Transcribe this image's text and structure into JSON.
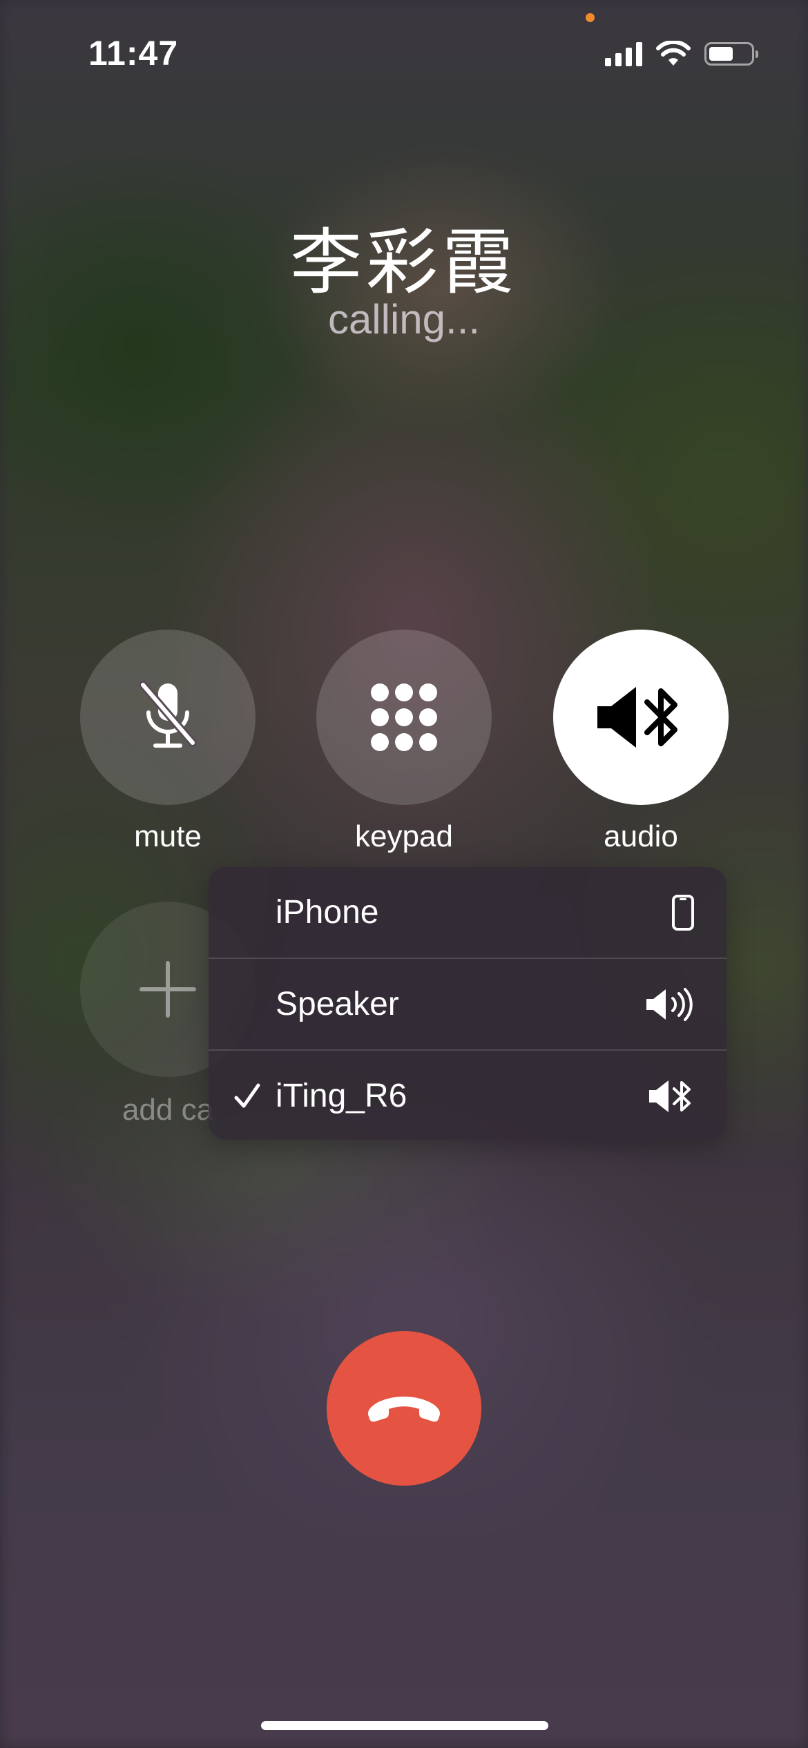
{
  "status_bar": {
    "time": "11:47"
  },
  "call": {
    "caller_name": "李彩霞",
    "status": "calling..."
  },
  "controls": {
    "mute_label": "mute",
    "keypad_label": "keypad",
    "audio_label": "audio",
    "add_call_label": "add ca"
  },
  "audio_menu": {
    "items": [
      {
        "label": "iPhone",
        "icon": "iphone-icon",
        "selected": false
      },
      {
        "label": "Speaker",
        "icon": "speaker-icon",
        "selected": false
      },
      {
        "label": "iTing_R6",
        "icon": "speaker-bluetooth-icon",
        "selected": true
      }
    ]
  },
  "colors": {
    "end_call": "#e55343",
    "privacy_dot": "#f08a2c"
  }
}
